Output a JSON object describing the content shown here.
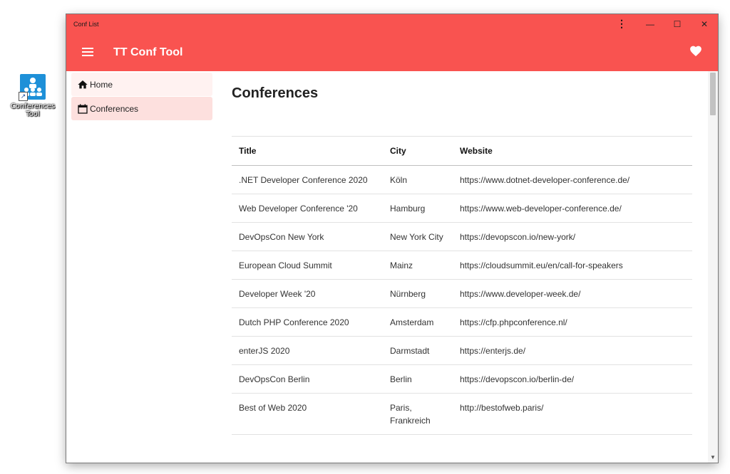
{
  "desktop": {
    "icon_label": "Conferences Tool"
  },
  "window": {
    "title": "Conf List",
    "menu_glyph": "⋮",
    "minimize_glyph": "—",
    "maximize_glyph": "☐",
    "close_glyph": "✕"
  },
  "appbar": {
    "title": "TT Conf Tool",
    "background": "#f95350",
    "favorite_icon": "heart-icon"
  },
  "sidebar": {
    "items": [
      {
        "label": "Home",
        "icon": "home-icon"
      },
      {
        "label": "Conferences",
        "icon": "calendar-icon"
      }
    ]
  },
  "main": {
    "title": "Conferences",
    "table": {
      "headers": [
        "Title",
        "City",
        "Website"
      ],
      "rows": [
        [
          ".NET Developer Conference 2020",
          "Köln",
          "https://www.dotnet-developer-conference.de/"
        ],
        [
          "Web Developer Conference '20",
          "Hamburg",
          "https://www.web-developer-conference.de/"
        ],
        [
          "DevOpsCon New York",
          "New York City",
          "https://devopscon.io/new-york/"
        ],
        [
          "European Cloud Summit",
          "Mainz",
          "https://cloudsummit.eu/en/call-for-speakers"
        ],
        [
          "Developer Week '20",
          "Nürnberg",
          "https://www.developer-week.de/"
        ],
        [
          "Dutch PHP Conference 2020",
          "Amsterdam",
          "https://cfp.phpconference.nl/"
        ],
        [
          "enterJS 2020",
          "Darmstadt",
          "https://enterjs.de/"
        ],
        [
          "DevOpsCon Berlin",
          "Berlin",
          "https://devopscon.io/berlin-de/"
        ],
        [
          "Best of Web 2020",
          "Paris, Frankreich",
          "http://bestofweb.paris/"
        ]
      ]
    }
  }
}
